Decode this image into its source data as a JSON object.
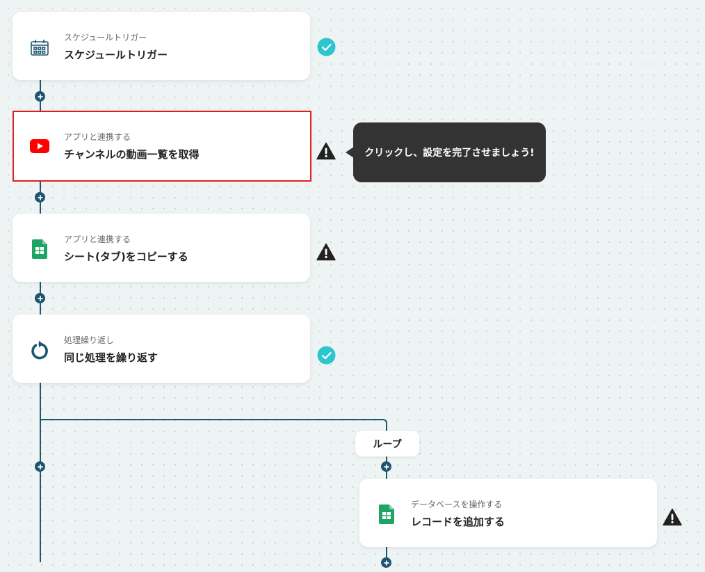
{
  "nodes": [
    {
      "subtitle": "スケジュールトリガー",
      "title": "スケジュールトリガー",
      "icon": "calendar-clock-icon",
      "status": "completed"
    },
    {
      "subtitle": "アプリと連携する",
      "title": "チャンネルの動画一覧を取得",
      "icon": "youtube-icon",
      "status": "warning",
      "selected": true
    },
    {
      "subtitle": "アプリと連携する",
      "title": "シート(タブ)をコピーする",
      "icon": "google-sheets-icon",
      "status": "warning"
    },
    {
      "subtitle": "処理繰り返し",
      "title": "同じ処理を繰り返す",
      "icon": "loop-arrow-icon",
      "status": "completed"
    },
    {
      "subtitle": "データベースを操作する",
      "title": "レコードを追加する",
      "icon": "google-sheets-icon",
      "status": "warning"
    }
  ],
  "tooltip": {
    "text": "クリックし、設定を完了させましょう!"
  },
  "loop": {
    "label": "ループ"
  },
  "colors": {
    "connector": "#1d5671",
    "completed": "#2ec4d0",
    "warning": "#222222",
    "selected_border": "#e02020",
    "youtube": "#ff0000",
    "sheets": "#1fa463",
    "background": "#eef4f3"
  }
}
